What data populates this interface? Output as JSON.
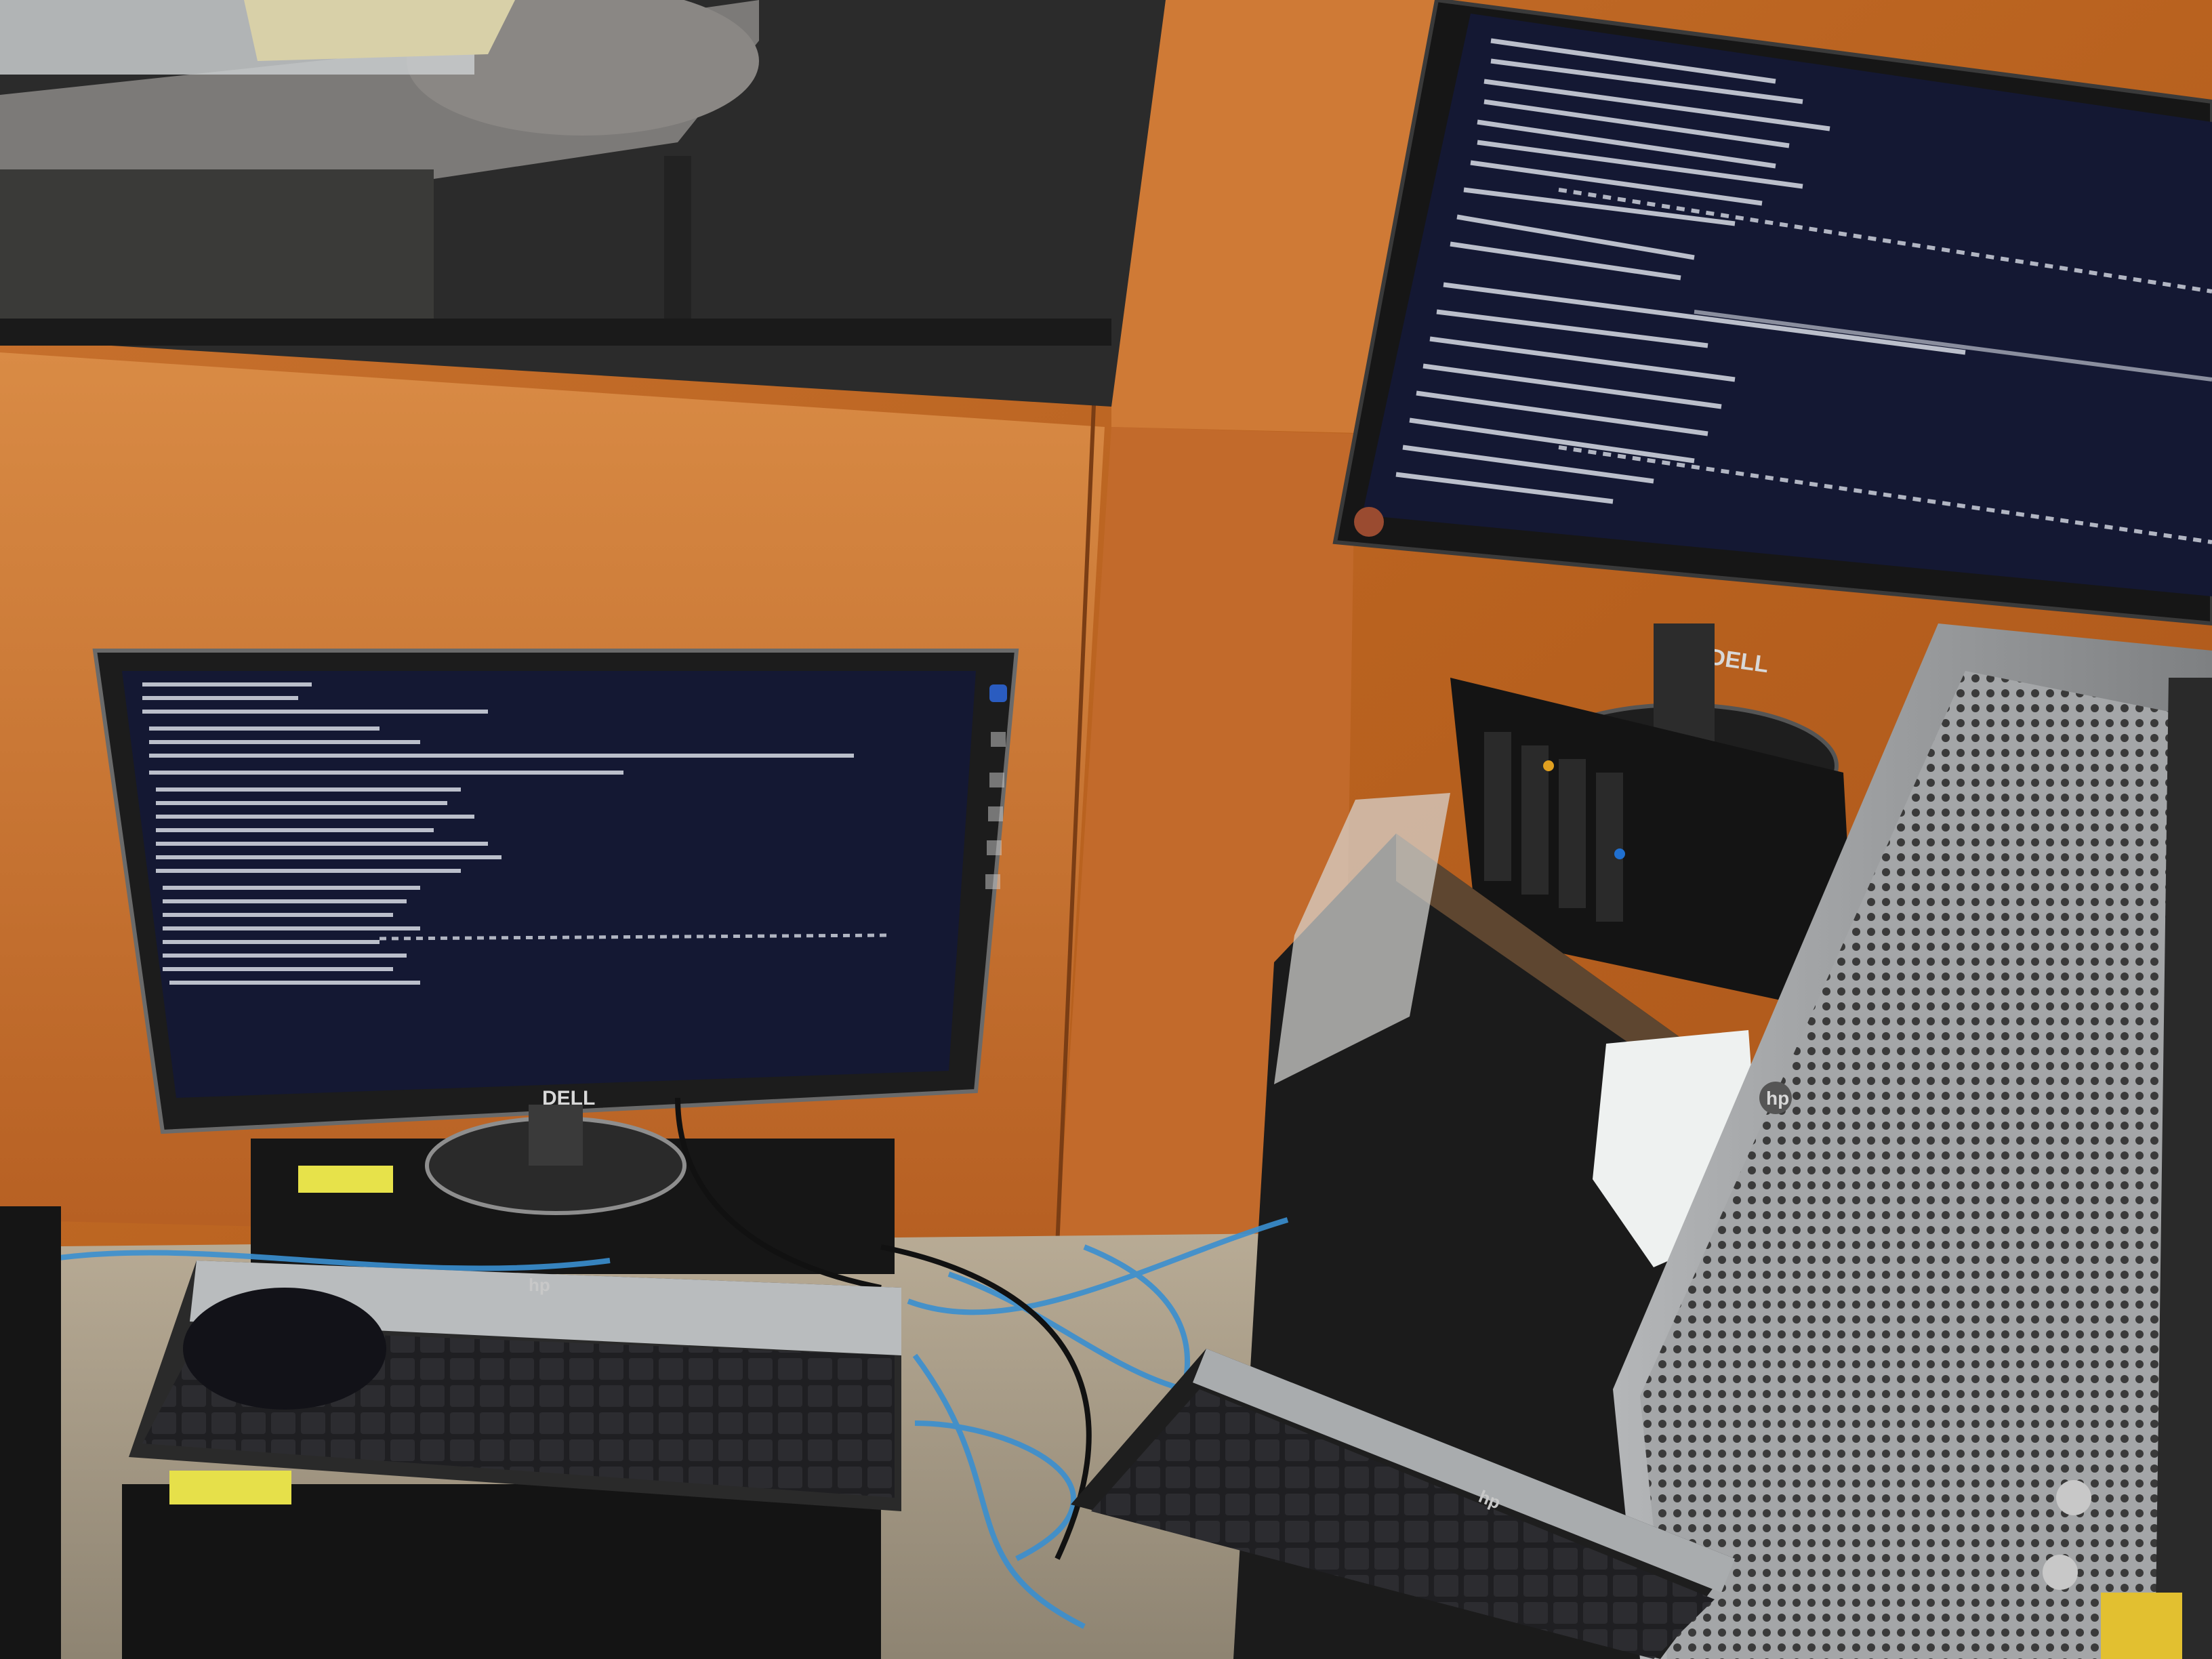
{
  "scene": {
    "description_tags": [
      "office-desk",
      "two-monitors",
      "terminal-output",
      "keyboards",
      "server-tower",
      "network-cables"
    ],
    "brands": {
      "left_monitor": "DELL",
      "right_monitor": "DELL",
      "left_keyboard": "hp",
      "right_keyboard": "hp",
      "server": "hp"
    },
    "colors": {
      "wood_panel": "#c46a2a",
      "terminal_bg": "#141833",
      "terminal_text": "#d9dde6",
      "server_silver": "#9a9c9e",
      "cable_blue": "#3a8fd0",
      "window_dark": "#2a2a2a"
    }
  }
}
